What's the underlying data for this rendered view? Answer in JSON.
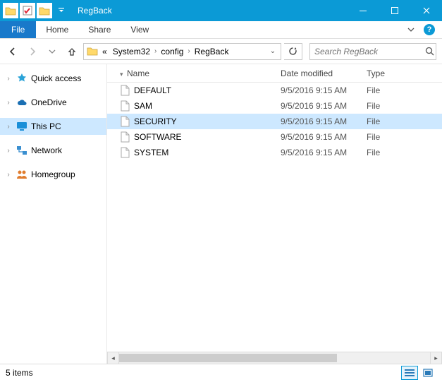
{
  "window": {
    "title": "RegBack"
  },
  "ribbon": {
    "file": "File",
    "tabs": [
      "Home",
      "Share",
      "View"
    ]
  },
  "breadcrumb": {
    "prefix": "«",
    "parts": [
      "System32",
      "config",
      "RegBack"
    ]
  },
  "search": {
    "placeholder": "Search RegBack"
  },
  "nav": {
    "items": [
      {
        "label": "Quick access",
        "icon": "star",
        "color": "#2aa3d8"
      },
      {
        "label": "OneDrive",
        "icon": "cloud",
        "color": "#1a6fb3"
      },
      {
        "label": "This PC",
        "icon": "monitor",
        "color": "#1a8fd8",
        "selected": true
      },
      {
        "label": "Network",
        "icon": "network",
        "color": "#3a8fd0"
      },
      {
        "label": "Homegroup",
        "icon": "people",
        "color": "#e07c2e"
      }
    ]
  },
  "columns": {
    "name": "Name",
    "date": "Date modified",
    "type": "Type"
  },
  "files": [
    {
      "name": "DEFAULT",
      "date": "9/5/2016 9:15 AM",
      "type": "File"
    },
    {
      "name": "SAM",
      "date": "9/5/2016 9:15 AM",
      "type": "File"
    },
    {
      "name": "SECURITY",
      "date": "9/5/2016 9:15 AM",
      "type": "File",
      "selected": true
    },
    {
      "name": "SOFTWARE",
      "date": "9/5/2016 9:15 AM",
      "type": "File"
    },
    {
      "name": "SYSTEM",
      "date": "9/5/2016 9:15 AM",
      "type": "File"
    }
  ],
  "status": {
    "count": "5 items"
  }
}
